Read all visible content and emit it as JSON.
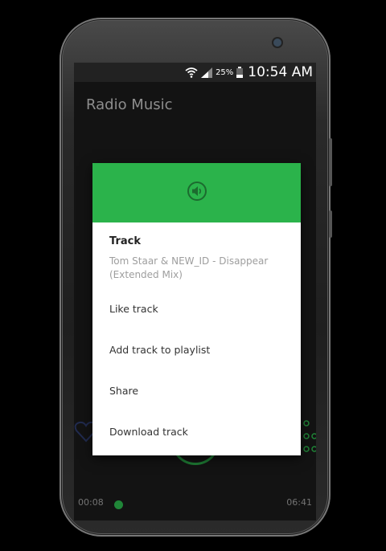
{
  "status_bar": {
    "battery_percent": "25%",
    "time": "10:54 AM"
  },
  "app": {
    "title": "Radio Music",
    "time_elapsed": "00:08",
    "time_total": "06:41"
  },
  "dialog": {
    "header_icon": "speaker-icon",
    "title": "Track",
    "subtitle": "Tom Staar & NEW_ID - Disappear (Extended Mix)",
    "items": [
      {
        "label": "Like track"
      },
      {
        "label": "Add track to playlist"
      },
      {
        "label": "Share"
      },
      {
        "label": "Download track"
      }
    ]
  },
  "colors": {
    "accent": "#2bb34b",
    "background": "#000000"
  }
}
